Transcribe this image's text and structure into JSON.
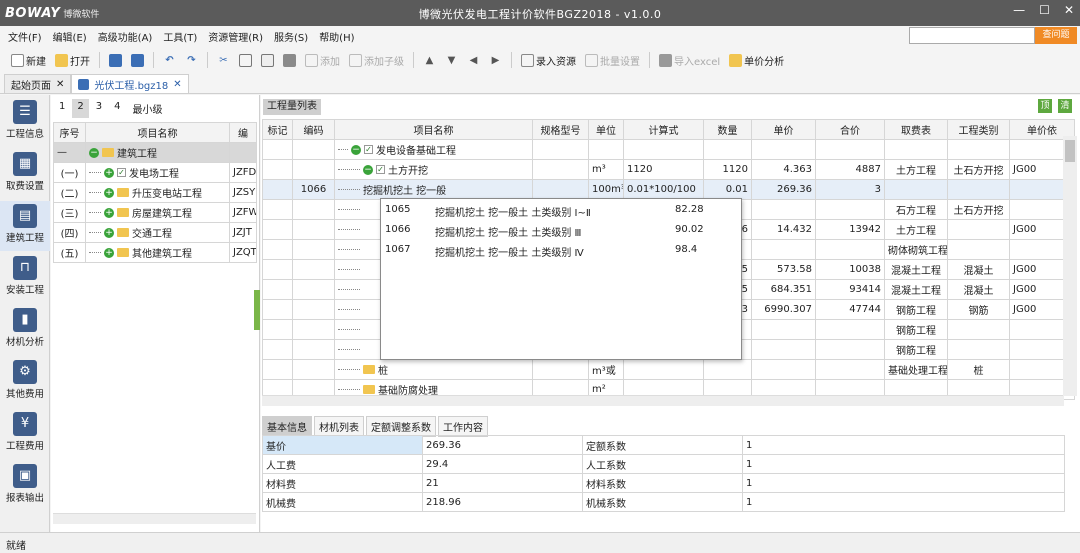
{
  "app": {
    "logo": "BOWAY",
    "logo_sub": "博微软件",
    "title": "博微光伏发电工程计价软件BGZ2018 - v1.0.0"
  },
  "window_buttons": {
    "minimize": "—",
    "maximize": "☐",
    "close": "✕"
  },
  "menu": [
    "文件(F)",
    "编辑(E)",
    "高级功能(A)",
    "工具(T)",
    "资源管理(R)",
    "服务(S)",
    "帮助(H)"
  ],
  "search": {
    "button": "查问题",
    "value": ""
  },
  "toolbar": {
    "new": "新建",
    "open": "打开",
    "add": "添加",
    "add_child": "添加子级",
    "import_resource": "录入资源",
    "batch_settings": "批量设置",
    "import_excel": "导入excel",
    "unit_price_analysis": "单价分析"
  },
  "doc_tabs": [
    {
      "label": "起始页面",
      "close": "✕"
    },
    {
      "label": "光伏工程.bgz18",
      "close": "✕"
    }
  ],
  "left_nav": [
    {
      "label": "工程信息",
      "icon": "list-icon"
    },
    {
      "label": "取费设置",
      "icon": "building-icon"
    },
    {
      "label": "建筑工程",
      "icon": "construction-icon"
    },
    {
      "label": "安装工程",
      "icon": "crane-icon"
    },
    {
      "label": "材机分析",
      "icon": "bar-chart-icon"
    },
    {
      "label": "其他费用",
      "icon": "gear-icon"
    },
    {
      "label": "工程费用",
      "icon": "money-icon"
    },
    {
      "label": "报表输出",
      "icon": "report-icon"
    }
  ],
  "left_panel": {
    "levels": [
      "1",
      "2",
      "3",
      "4",
      "最小级"
    ],
    "headers": [
      "序号",
      "项目名称",
      "编"
    ],
    "rows": [
      {
        "seq": "—",
        "name": "建筑工程",
        "code": ""
      },
      {
        "seq": "(一)",
        "name": "发电场工程",
        "code": "JZFD"
      },
      {
        "seq": "(二)",
        "name": "升压变电站工程",
        "code": "JZSY"
      },
      {
        "seq": "(三)",
        "name": "房屋建筑工程",
        "code": "JZFW"
      },
      {
        "seq": "(四)",
        "name": "交通工程",
        "code": "JZJT"
      },
      {
        "seq": "(五)",
        "name": "其他建筑工程",
        "code": "JZQT"
      }
    ]
  },
  "main": {
    "title": "工程量列表",
    "right_icons": [
      "顶",
      "清"
    ],
    "headers": [
      "标记",
      "编码",
      "项目名称",
      "规格型号",
      "单位",
      "计算式",
      "数量",
      "单价",
      "合价",
      "取费表",
      "工程类别",
      "单价依"
    ],
    "rows": [
      {
        "mark": "",
        "code": "",
        "name": "发电设备基础工程",
        "spec": "",
        "unit": "",
        "formula": "",
        "qty": "",
        "price": "",
        "total": "",
        "fee": "",
        "cat": "",
        "basis": ""
      },
      {
        "mark": "",
        "code": "",
        "name": "土方开挖",
        "spec": "",
        "unit": "m³",
        "formula": "1120",
        "qty": "1120",
        "price": "4.363",
        "total": "4887",
        "fee": "土方工程",
        "cat": "土石方开挖",
        "basis": "JG00"
      },
      {
        "mark": "",
        "code": "1066",
        "name": "挖掘机挖土 挖一般",
        "spec": "",
        "unit": "100m³",
        "formula": "0.01*100/100",
        "qty": "0.01",
        "price": "269.36",
        "total": "3",
        "fee": "",
        "cat": "",
        "basis": ""
      },
      {
        "mark": "",
        "code": "",
        "name": "",
        "spec": "",
        "unit": "",
        "formula": "",
        "qty": "",
        "price": "",
        "total": "",
        "fee": "石方工程",
        "cat": "土石方开挖",
        "basis": ""
      },
      {
        "mark": "",
        "code": "",
        "name": "",
        "spec": "",
        "unit": "",
        "formula": "",
        "qty": "56",
        "price": "14.432",
        "total": "13942",
        "fee": "土方工程",
        "cat": "",
        "basis": "JG00"
      },
      {
        "mark": "",
        "code": "",
        "name": "",
        "spec": "",
        "unit": "",
        "formula": "",
        "qty": "",
        "price": "",
        "total": "",
        "fee": "砌体砌筑工程",
        "cat": "",
        "basis": ""
      },
      {
        "mark": "",
        "code": "",
        "name": "",
        "spec": "",
        "unit": "",
        "formula": "",
        "qty": "7.5",
        "price": "573.58",
        "total": "10038",
        "fee": "混凝土工程",
        "cat": "混凝土",
        "basis": "JG00"
      },
      {
        "mark": "",
        "code": "",
        "name": "",
        "spec": "",
        "unit": "",
        "formula": "",
        "qty": "5.5",
        "price": "684.351",
        "total": "93414",
        "fee": "混凝土工程",
        "cat": "混凝土",
        "basis": "JG00"
      },
      {
        "mark": "",
        "code": "",
        "name": "",
        "spec": "",
        "unit": "",
        "formula": "",
        "qty": "83",
        "price": "6990.307",
        "total": "47744",
        "fee": "钢筋工程",
        "cat": "钢筋",
        "basis": "JG00"
      },
      {
        "mark": "",
        "code": "",
        "name": "",
        "spec": "",
        "unit": "",
        "formula": "",
        "qty": "",
        "price": "",
        "total": "",
        "fee": "钢筋工程",
        "cat": "",
        "basis": ""
      },
      {
        "mark": "",
        "code": "",
        "name": "",
        "spec": "",
        "unit": "",
        "formula": "",
        "qty": "",
        "price": "",
        "total": "",
        "fee": "钢筋工程",
        "cat": "",
        "basis": ""
      },
      {
        "mark": "",
        "code": "",
        "name": "桩",
        "spec": "",
        "unit": "m³或",
        "formula": "",
        "qty": "",
        "price": "",
        "total": "",
        "fee": "基础处理工程",
        "cat": "桩",
        "basis": ""
      },
      {
        "mark": "",
        "code": "",
        "name": "基础防腐处理",
        "spec": "",
        "unit": "m²",
        "formula": "",
        "qty": "",
        "price": "",
        "total": "",
        "fee": "",
        "cat": "",
        "basis": ""
      }
    ]
  },
  "dropdown": [
    {
      "code": "1065",
      "name": "挖掘机挖土 挖一般土 土类级别 Ⅰ~Ⅱ",
      "price": "82.28"
    },
    {
      "code": "1066",
      "name": "挖掘机挖土 挖一般土 土类级别 Ⅲ",
      "price": "90.02"
    },
    {
      "code": "1067",
      "name": "挖掘机挖土 挖一般土 土类级别 Ⅳ",
      "price": "98.4"
    }
  ],
  "bottom_tabs": [
    "基本信息",
    "材机列表",
    "定额调整系数",
    "工作内容"
  ],
  "bottom_rows": [
    {
      "k1": "基价",
      "v1": "269.36",
      "k2": "定额系数",
      "v2": "1"
    },
    {
      "k1": "人工费",
      "v1": "29.4",
      "k2": "人工系数",
      "v2": "1"
    },
    {
      "k1": "材料费",
      "v1": "21",
      "k2": "材料系数",
      "v2": "1"
    },
    {
      "k1": "机械费",
      "v1": "218.96",
      "k2": "机械系数",
      "v2": "1"
    }
  ],
  "status": "就绪"
}
